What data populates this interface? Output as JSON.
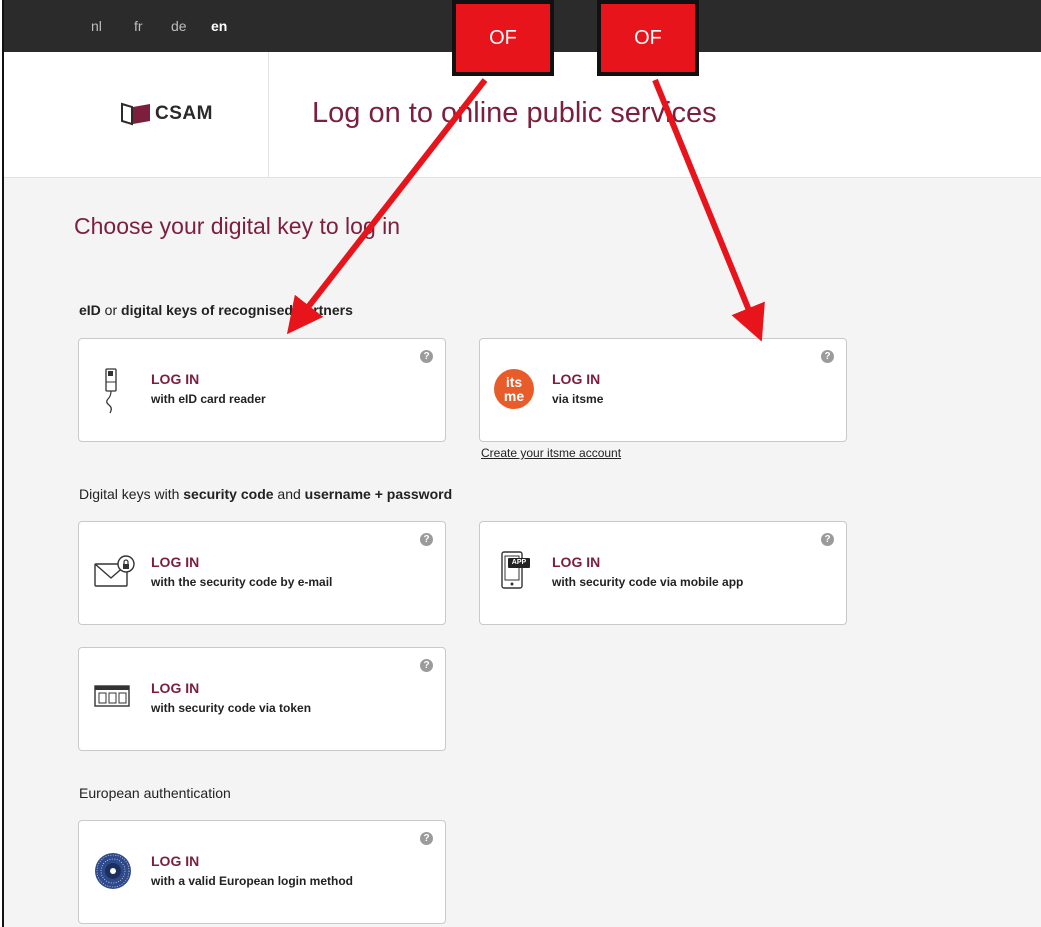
{
  "languages": [
    {
      "code": "nl",
      "active": false
    },
    {
      "code": "fr",
      "active": false
    },
    {
      "code": "de",
      "active": false
    },
    {
      "code": "en",
      "active": true
    }
  ],
  "header": {
    "logo_text": "CSAM",
    "title": "Log on to online public services"
  },
  "main": {
    "title": "Choose your digital key to log in"
  },
  "sections": {
    "eid": {
      "p1": "eID",
      "p2": " or ",
      "p3": "digital keys of recognised partners"
    },
    "security": {
      "p1": "Digital keys with ",
      "p2": "security code",
      "p3": " and ",
      "p4": "username + password"
    },
    "european": {
      "label": "European authentication"
    }
  },
  "cards": {
    "eid": {
      "login": "LOG IN",
      "desc": "with eID card reader",
      "icon": "card-reader-icon"
    },
    "itsme": {
      "login": "LOG IN",
      "desc": "via itsme",
      "icon": "itsme-logo-icon",
      "logo_text": "its me",
      "link": "Create your itsme account"
    },
    "email": {
      "login": "LOG IN",
      "desc": "with the security code by e-mail",
      "icon": "email-lock-icon"
    },
    "mobile": {
      "login": "LOG IN",
      "desc": "with security code via mobile app",
      "icon": "mobile-app-icon",
      "app_badge": "APP"
    },
    "token": {
      "login": "LOG IN",
      "desc": "with security code via token",
      "icon": "token-icon"
    },
    "european": {
      "login": "LOG IN",
      "desc": "with a valid European login method",
      "icon": "eu-stars-icon"
    }
  },
  "help_icon": "?",
  "annotations": {
    "left": "OF",
    "right": "OF"
  },
  "colors": {
    "brand": "#7b1f3c",
    "topbar": "#2b2b2b",
    "itsme": "#e85c2b",
    "annotation": "#e8141b"
  }
}
